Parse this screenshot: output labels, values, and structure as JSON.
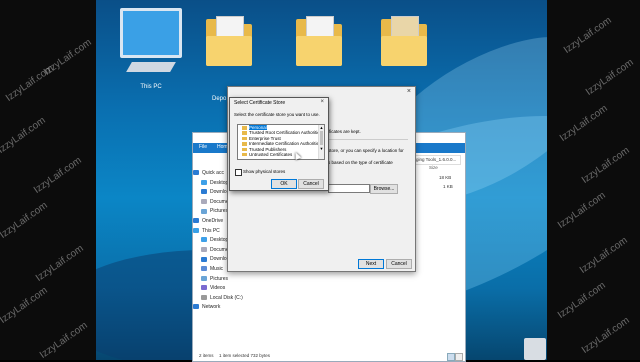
{
  "watermark": "IzzyLaif.com",
  "desktop": {
    "icons": [
      {
        "label": "This PC"
      },
      {
        "label": "Depo"
      }
    ]
  },
  "explorer": {
    "ribbon_tabs": [
      "File",
      "Home"
    ],
    "nav_items": [
      "Quick acc",
      "Desktop",
      "Downlo",
      "Docume",
      "Pictures",
      "OneDrive",
      "This PC",
      "Desktop",
      "Docume",
      "Downlo",
      "Music",
      "Pictures",
      "Videos",
      "Local Disk (C:)",
      "Network"
    ],
    "status_left": "2 items",
    "status_mid": "1 item selected  732 bytes",
    "column_size": "Size",
    "sizes": [
      "18 KB",
      "1 KB"
    ],
    "path_fragment": "ging Tools_1.6.0.0..."
  },
  "wizard": {
    "text1": "ificates are kept.",
    "text2": "store, or you can specify a location for",
    "text3": "s based on the type of certificate",
    "browse_label": "Browse...",
    "next_label": "Next",
    "cancel_label": "Cancel"
  },
  "dialog": {
    "title": "Select Certificate Store",
    "instruction": "Select the certificate store you want to use.",
    "stores": [
      "Personal",
      "Trusted Root Certification Authorities",
      "Enterprise Trust",
      "Intermediate Certification Authorities",
      "Trusted Publishers",
      "Untrusted Certificates"
    ],
    "selected_index": 0,
    "show_physical_label": "Show physical stores",
    "ok_label": "OK",
    "cancel_label": "Cancel"
  }
}
